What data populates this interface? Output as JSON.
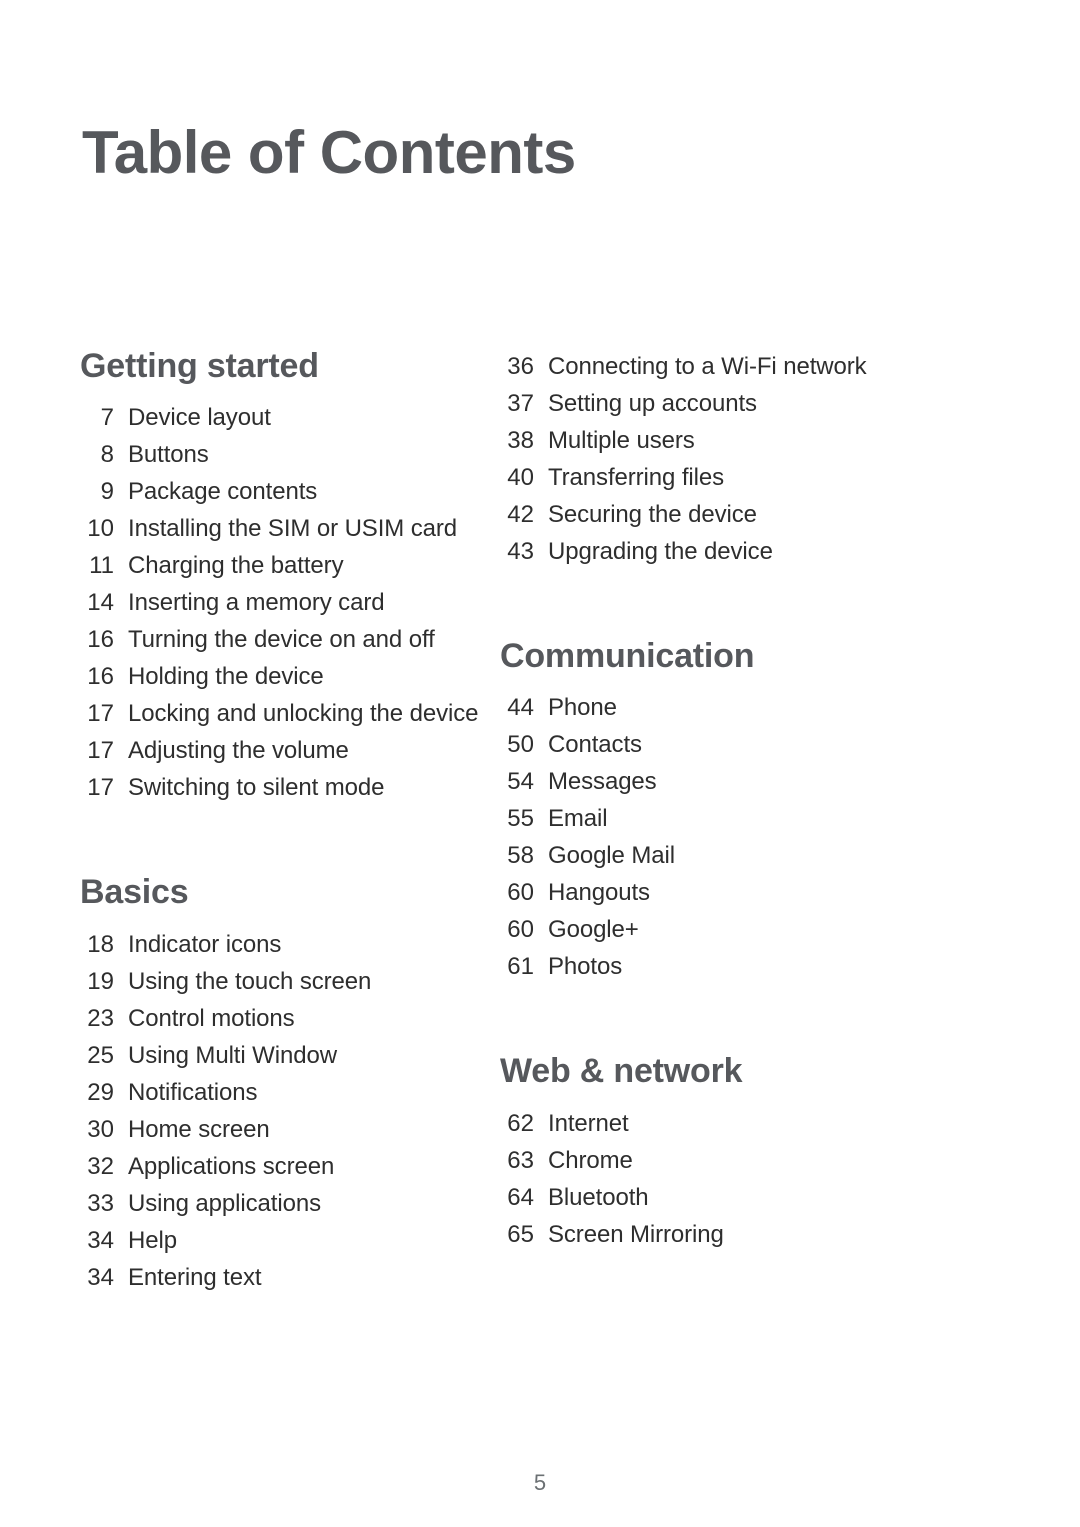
{
  "document": {
    "title": "Table of Contents",
    "page_number": "5"
  },
  "colors": {
    "heading": "#56585c",
    "body_text": "#2e2e2e",
    "page_number": "#6b7073",
    "background": "#ffffff"
  },
  "columns": [
    {
      "name": "left-column",
      "sections": [
        {
          "heading": "Getting started",
          "entries": [
            {
              "page": "7",
              "title": "Device layout"
            },
            {
              "page": "8",
              "title": "Buttons"
            },
            {
              "page": "9",
              "title": "Package contents"
            },
            {
              "page": "10",
              "title": "Installing the SIM or USIM card"
            },
            {
              "page": "11",
              "title": "Charging the battery"
            },
            {
              "page": "14",
              "title": "Inserting a memory card"
            },
            {
              "page": "16",
              "title": "Turning the device on and off"
            },
            {
              "page": "16",
              "title": "Holding the device"
            },
            {
              "page": "17",
              "title": "Locking and unlocking the device"
            },
            {
              "page": "17",
              "title": "Adjusting the volume"
            },
            {
              "page": "17",
              "title": "Switching to silent mode"
            }
          ]
        },
        {
          "heading": "Basics",
          "entries": [
            {
              "page": "18",
              "title": "Indicator icons"
            },
            {
              "page": "19",
              "title": "Using the touch screen"
            },
            {
              "page": "23",
              "title": "Control motions"
            },
            {
              "page": "25",
              "title": "Using Multi Window"
            },
            {
              "page": "29",
              "title": "Notifications"
            },
            {
              "page": "30",
              "title": "Home screen"
            },
            {
              "page": "32",
              "title": "Applications screen"
            },
            {
              "page": "33",
              "title": "Using applications"
            },
            {
              "page": "34",
              "title": "Help"
            },
            {
              "page": "34",
              "title": "Entering text"
            }
          ]
        }
      ]
    },
    {
      "name": "right-column",
      "sections": [
        {
          "heading": "",
          "entries": [
            {
              "page": "36",
              "title": "Connecting to a Wi-Fi network"
            },
            {
              "page": "37",
              "title": "Setting up accounts"
            },
            {
              "page": "38",
              "title": "Multiple users"
            },
            {
              "page": "40",
              "title": "Transferring files"
            },
            {
              "page": "42",
              "title": "Securing the device"
            },
            {
              "page": "43",
              "title": "Upgrading the device"
            }
          ]
        },
        {
          "heading": "Communication",
          "entries": [
            {
              "page": "44",
              "title": "Phone"
            },
            {
              "page": "50",
              "title": "Contacts"
            },
            {
              "page": "54",
              "title": "Messages"
            },
            {
              "page": "55",
              "title": "Email"
            },
            {
              "page": "58",
              "title": "Google Mail"
            },
            {
              "page": "60",
              "title": "Hangouts"
            },
            {
              "page": "60",
              "title": "Google+"
            },
            {
              "page": "61",
              "title": "Photos"
            }
          ]
        },
        {
          "heading": "Web & network",
          "entries": [
            {
              "page": "62",
              "title": "Internet"
            },
            {
              "page": "63",
              "title": "Chrome"
            },
            {
              "page": "64",
              "title": "Bluetooth"
            },
            {
              "page": "65",
              "title": "Screen Mirroring"
            }
          ]
        }
      ]
    }
  ]
}
